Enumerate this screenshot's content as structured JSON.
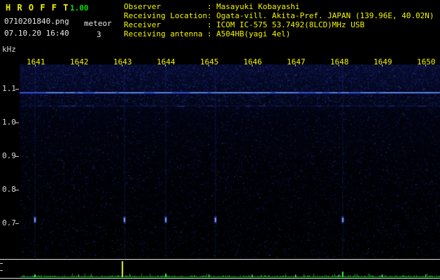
{
  "header": {
    "app_name": "H R O F F T",
    "version": "1.00",
    "filename": "0710201840.png",
    "mode": "meteor",
    "datetime": "07.10.20 16:40",
    "count": "3",
    "info": [
      {
        "label": "Observer",
        "value": ": Masayuki Kobayashi"
      },
      {
        "label": "Receiving Location",
        "value": ": Ogata-vill. Akita-Pref. JAPAN (139.96E, 40.02N)"
      },
      {
        "label": "Receiver",
        "value": ": ICOM IC-575 53.7492(8LCD)MHz USB"
      },
      {
        "label": "Receiving antenna",
        "value": ": A504HB(yagi 4el)"
      }
    ]
  },
  "colors": {
    "label_yellow": "#f5f500",
    "version_green": "#00dd00",
    "white_text": "#e8e8e8",
    "carrier_blue": "#4670ff",
    "echo_blue": "#78aaff",
    "strip_green": "#2aff2a",
    "strip_spike_yellow": "#d8f840"
  },
  "chart_data": {
    "type": "heatmap",
    "title": "",
    "xlabel_ticks": [
      "1641",
      "1642",
      "1643",
      "1644",
      "1645",
      "1646",
      "1647",
      "1648",
      "1649",
      "1650"
    ],
    "ylabel": "kHz",
    "y_ticks": [
      "1.1",
      "1.0",
      "0.9",
      "0.8",
      "0.7"
    ],
    "y_range_khz": [
      0.6,
      1.17
    ],
    "grid": false,
    "carrier_lines_khz": [
      1.09,
      1.05
    ],
    "echoes": [
      {
        "t": 1641.0,
        "f": 0.71
      },
      {
        "t": 1643.06,
        "f": 0.71
      },
      {
        "t": 1644.02,
        "f": 0.71
      },
      {
        "t": 1645.16,
        "f": 0.71
      },
      {
        "t": 1648.1,
        "f": 0.71
      }
    ],
    "signal_spikes": [
      {
        "t": 1641.0,
        "level": 0.15
      },
      {
        "t": 1643.02,
        "level": 0.92
      },
      {
        "t": 1644.02,
        "level": 0.2
      },
      {
        "t": 1648.1,
        "level": 0.33
      }
    ]
  }
}
